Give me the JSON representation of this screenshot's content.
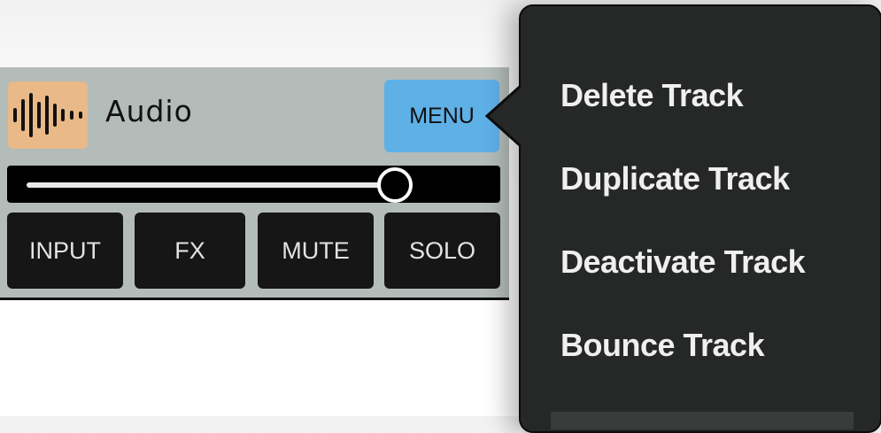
{
  "track": {
    "name": "Audio",
    "icon": "audio-waveform-icon",
    "icon_bg": "#e9b987",
    "menu_label": "MENU",
    "volume_level": 0.81,
    "buttons": [
      "INPUT",
      "FX",
      "MUTE",
      "SOLO"
    ]
  },
  "popup_menu": {
    "items": [
      "Delete Track",
      "Duplicate Track",
      "Deactivate Track",
      "Bounce Track"
    ]
  },
  "colors": {
    "track_bg": "#b3bcb9",
    "menu_button": "#5fb0e6",
    "popup_bg": "#262727"
  }
}
